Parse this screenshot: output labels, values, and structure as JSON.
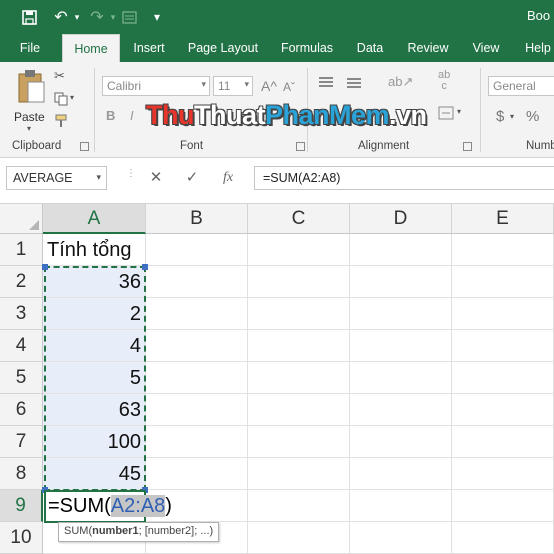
{
  "title": "Boo",
  "tabs": [
    "File",
    "Home",
    "Insert",
    "Page Layout",
    "Formulas",
    "Data",
    "Review",
    "View",
    "Help"
  ],
  "active_tab": "Home",
  "clipboard": {
    "paste_label": "Paste",
    "group_label": "Clipboard"
  },
  "font": {
    "name": "Calibri",
    "size": "11",
    "group_label": "Font",
    "bold": "B",
    "italic": "I",
    "grow": "A",
    "shrink": "A"
  },
  "alignment": {
    "group_label": "Alignment"
  },
  "number": {
    "format": "General",
    "group_label": "Numb",
    "currency": "$",
    "percent": "%"
  },
  "watermark": {
    "part1": "Thu",
    "part2": "Thuat",
    "part3": "PhanMem",
    "part4": ".vn"
  },
  "namebox": "AVERAGE",
  "fx_label": "fx",
  "formula": "=SUM(A2:A8)",
  "columns": [
    "A",
    "B",
    "C",
    "D",
    "E"
  ],
  "rows": [
    "1",
    "2",
    "3",
    "4",
    "5",
    "6",
    "7",
    "8",
    "9",
    "10"
  ],
  "cells": {
    "a1": "Tính tổng",
    "a2": "36",
    "a3": "2",
    "a4": "4",
    "a5": "5",
    "a6": "63",
    "a7": "100",
    "a8": "45"
  },
  "edit": {
    "prefix": "=SUM(",
    "ref": "A2:A8",
    "suffix": ")"
  },
  "tooltip": {
    "func": "SUM(",
    "arg1": "number1",
    "rest": "; [number2]; ...)"
  },
  "colors": {
    "excel_green": "#217346",
    "ref_blue": "#2f5fb3"
  }
}
